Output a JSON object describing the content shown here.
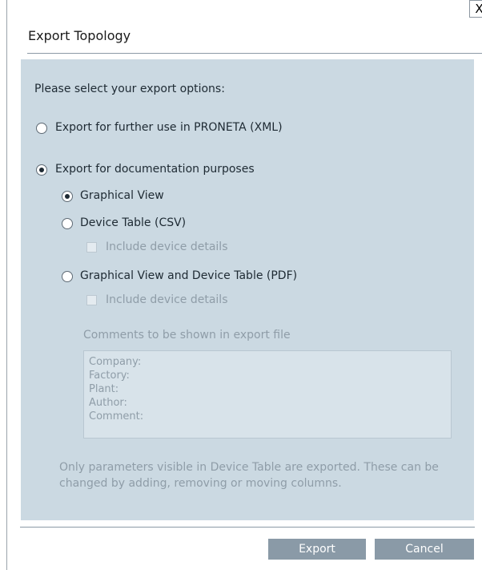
{
  "dialog": {
    "title": "Export Topology",
    "close_glyph": "X"
  },
  "options": {
    "prompt": "Please select your export options:",
    "xml_label": "Export for further use in PRONETA (XML)",
    "doc_label": "Export for documentation purposes",
    "selected": "doc"
  },
  "documentation": {
    "graphical_label": "Graphical View",
    "csv_label": "Device Table (CSV)",
    "csv_details_label": "Include device details",
    "pdf_label": "Graphical View and Device Table (PDF)",
    "pdf_details_label": "Include device details",
    "selected": "graphical"
  },
  "comments": {
    "label": "Comments to be shown in export file",
    "lines": [
      "Company:",
      "Factory:",
      "Plant:",
      "Author:",
      "Comment:"
    ]
  },
  "note": "Only parameters visible in Device Table are exported. These can be changed by adding, removing or moving columns.",
  "buttons": {
    "export": "Export",
    "cancel": "Cancel"
  },
  "colors": {
    "panel_bg": "#cbd9e2",
    "button_bg": "#8a9aa7",
    "disabled_text": "#8f9da8"
  },
  "icons": {
    "close": "close-icon"
  }
}
